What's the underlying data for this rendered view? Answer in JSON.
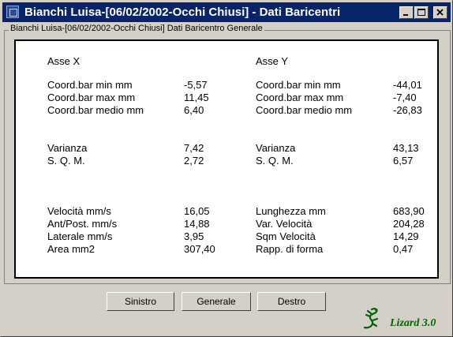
{
  "window": {
    "title": "Bianchi Luisa-[06/02/2002-Occhi Chiusi] - Dati Baricentri",
    "controls": [
      "minimize",
      "maximize",
      "close"
    ]
  },
  "group": {
    "label": "Bianchi Luisa-[06/02/2002-Occhi Chiusi] Dati Baricentro Generale"
  },
  "asse_x": {
    "header": "Asse X",
    "rows": [
      {
        "label": "Coord.bar min mm",
        "value": "-5,57"
      },
      {
        "label": "Coord.bar max mm",
        "value": "11,45"
      },
      {
        "label": "Coord.bar medio mm",
        "value": "6,40"
      },
      {
        "label": "Varianza",
        "value": "7,42"
      },
      {
        "label": "S. Q. M.",
        "value": "2,72"
      },
      {
        "label": "Velocità mm/s",
        "value": "16,05"
      },
      {
        "label": "Ant/Post. mm/s",
        "value": "14,88"
      },
      {
        "label": "Laterale mm/s",
        "value": "3,95"
      },
      {
        "label": "Area mm2",
        "value": "307,40"
      }
    ]
  },
  "asse_y": {
    "header": "Asse Y",
    "rows": [
      {
        "label": "Coord.bar min mm",
        "value": "-44,01"
      },
      {
        "label": "Coord.bar max mm",
        "value": "-7,40"
      },
      {
        "label": "Coord.bar medio mm",
        "value": "-26,83"
      },
      {
        "label": "Varianza",
        "value": "43,13"
      },
      {
        "label": "S. Q. M.",
        "value": "6,57"
      },
      {
        "label": "Lunghezza mm",
        "value": "683,90"
      },
      {
        "label": "Var. Velocità",
        "value": "204,28"
      },
      {
        "label": "Sqm Velocità",
        "value": "14,29"
      },
      {
        "label": "Rapp. di forma",
        "value": "0,47"
      }
    ]
  },
  "buttons": {
    "sinistro": "Sinistro",
    "generale": "Generale",
    "destro": "Destro"
  },
  "logo": {
    "text": "Lizard 3.0",
    "icon": "lizard-icon",
    "color": "#006400"
  },
  "colors": {
    "titlebar": "#08246b",
    "face": "#d4d0c8"
  }
}
